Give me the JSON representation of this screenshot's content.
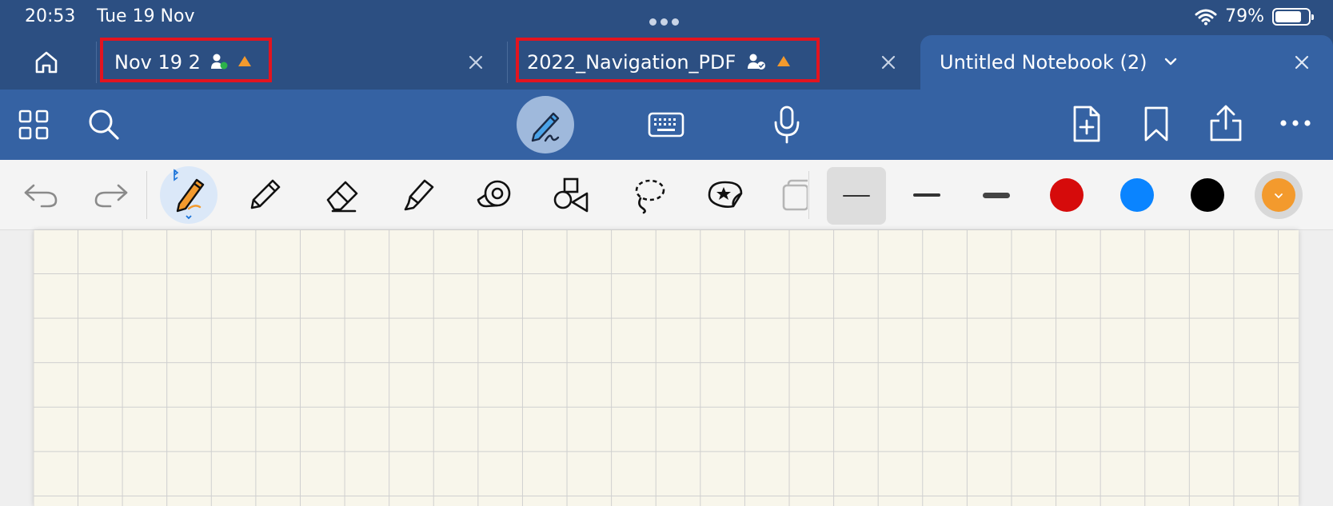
{
  "status_bar": {
    "time": "20:53",
    "date": "Tue 19 Nov",
    "battery_percent": "79%",
    "battery_level": 0.79
  },
  "tabs": [
    {
      "label": "Nov 19 2",
      "status_icons": [
        "shared-user-icon",
        "warning-icon"
      ],
      "active": false,
      "highlighted": true
    },
    {
      "label": "2022_Navigation_PDF",
      "status_icons": [
        "shared-user-icon",
        "warning-icon"
      ],
      "active": false,
      "highlighted": true
    },
    {
      "label": "Untitled Notebook (2)",
      "status_icons": [
        "chevron-down-icon"
      ],
      "active": true,
      "highlighted": false
    }
  ],
  "main_toolbar": {
    "left_icons": [
      "thumbnails-grid-icon",
      "search-icon"
    ],
    "center_icons": [
      "pen-mode-icon",
      "keyboard-icon",
      "microphone-icon"
    ],
    "right_icons": [
      "add-page-icon",
      "bookmark-icon",
      "share-icon",
      "more-icon"
    ],
    "active_mode": "pen-mode-icon"
  },
  "tools": {
    "items": [
      "undo-icon",
      "redo-icon",
      "pen-icon",
      "pencil-icon",
      "eraser-icon",
      "highlighter-icon",
      "tape-icon",
      "shapes-icon",
      "lasso-icon",
      "sticker-icon",
      "image-icon"
    ],
    "selected": "pen-icon",
    "stroke_widths": [
      "thin",
      "medium",
      "thick"
    ],
    "selected_width": "thin",
    "colors": [
      "#d60b0b",
      "#0a84ff",
      "#000000",
      "#f39a2d"
    ]
  },
  "colors": {
    "status_bg": "#2c4f82",
    "toolbar_bg": "#3562a3",
    "highlight_box": "#e3141f",
    "warning": "#f39a2d",
    "paper": "#f8f6eb"
  }
}
